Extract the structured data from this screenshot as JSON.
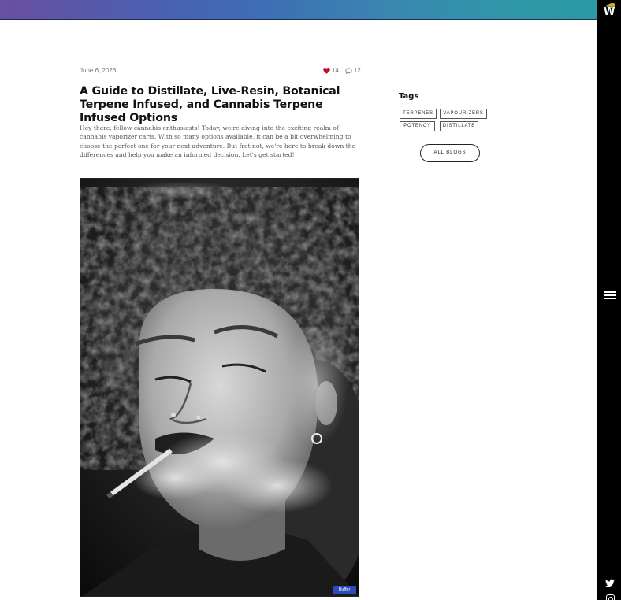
{
  "brand": {
    "logo_letter": "W",
    "colors": {
      "leaf_green": "#7aa33a",
      "leaf_orange": "#e9a21d",
      "rail": "#000000",
      "heart": "#c8102e"
    }
  },
  "nav": {
    "menu_icon": "hamburger-menu-icon",
    "social": [
      "twitter-icon",
      "instagram-icon"
    ]
  },
  "post": {
    "date": "June 6, 2023",
    "likes": "14",
    "comments": "12",
    "title": "A Guide to Distillate, Live-Resin, Botanical Terpene Infused, and Cannabis Terpene Infused Options",
    "intro": "Hey there, fellow cannabis enthusiasts! Today, we're diving into the exciting realm of cannabis vaporizer carts. With so many options available, it can be a bit overwhelming to choose the perfect one for your next adventure. But fret not, we're here to break down the differences and help you make an informed decision. Let's get started!",
    "buffer_label": "Buffer"
  },
  "sidebar": {
    "tags_heading": "Tags",
    "tags": [
      "TERPENES",
      "VAPOURIZERS",
      "POTENCY",
      "DISTILLATE"
    ],
    "all_blogs_label": "ALL BLOGS"
  }
}
